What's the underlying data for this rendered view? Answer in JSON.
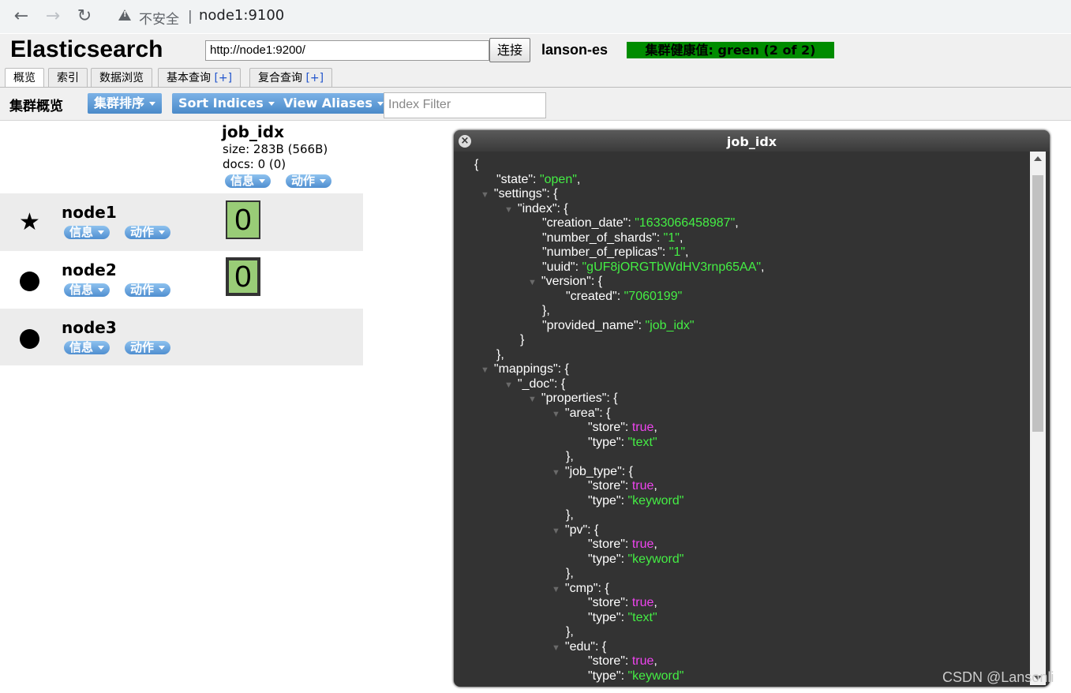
{
  "browser": {
    "back_icon": "arrow-left-icon",
    "forward_icon": "arrow-right-icon",
    "reload_icon": "reload-icon",
    "security_label": "不安全",
    "url": "node1:9100"
  },
  "header": {
    "title": "Elasticsearch",
    "connect_url": "http://node1:9200/",
    "connect_label": "连接",
    "cluster_name": "lanson-es",
    "health": "集群健康值: green (2 of 2)",
    "health_color": "#008c00"
  },
  "tabs": [
    {
      "label": "概览",
      "plus": ""
    },
    {
      "label": "索引",
      "plus": ""
    },
    {
      "label": "数据浏览",
      "plus": ""
    },
    {
      "label": "基本查询",
      "plus": "[+]"
    },
    {
      "label": "复合查询",
      "plus": "[+]"
    }
  ],
  "toolbar": {
    "title": "集群概览",
    "buttons": [
      "集群排序",
      "Sort Indices",
      "View Aliases"
    ],
    "filter_placeholder": "Index Filter",
    "button_color": "#4a8ac9"
  },
  "index": {
    "name": "job_idx",
    "size": "size: 283B (566B)",
    "docs": "docs: 0 (0)",
    "info_label": "信息",
    "action_label": "动作"
  },
  "nodes": [
    {
      "name": "node1",
      "marker": "star-icon",
      "shard": "0"
    },
    {
      "name": "node2",
      "marker": "dot-icon",
      "shard": "0"
    },
    {
      "name": "node3",
      "marker": "dot-icon",
      "shard": ""
    }
  ],
  "node_info_label": "信息",
  "node_action_label": "动作",
  "dialog": {
    "title": "job_idx",
    "lines": [
      {
        "t": "{"
      },
      {
        "k": "state",
        "v": "\"open\"",
        "vt": "s",
        "end": ","
      },
      {
        "k": "settings",
        "open": true
      },
      {
        "k": "index",
        "open": true
      },
      {
        "k": "creation_date",
        "v": "\"1633066458987\"",
        "vt": "s",
        "end": ","
      },
      {
        "k": "number_of_shards",
        "v": "\"1\"",
        "vt": "s",
        "end": ","
      },
      {
        "k": "number_of_replicas",
        "v": "\"1\"",
        "vt": "s",
        "end": ","
      },
      {
        "k": "uuid",
        "v": "\"gUF8jORGTbWdHV3rnp65AA\"",
        "vt": "s",
        "end": ","
      },
      {
        "k": "version",
        "open": true
      },
      {
        "k": "created",
        "v": "\"7060199\"",
        "vt": "s",
        "end": ""
      },
      {
        "t": "},"
      },
      {
        "k": "provided_name",
        "v": "\"job_idx\"",
        "vt": "s",
        "end": ""
      },
      {
        "t": "}"
      },
      {
        "t": "},"
      },
      {
        "k": "mappings",
        "open": true
      },
      {
        "k": "_doc",
        "open": true
      },
      {
        "k": "properties",
        "open": true
      },
      {
        "k": "area",
        "open": true
      },
      {
        "k": "store",
        "v": "true",
        "vt": "b",
        "end": ","
      },
      {
        "k": "type",
        "v": "\"text\"",
        "vt": "s",
        "end": ""
      },
      {
        "t": "},"
      },
      {
        "k": "job_type",
        "open": true
      },
      {
        "k": "store",
        "v": "true",
        "vt": "b",
        "end": ","
      },
      {
        "k": "type",
        "v": "\"keyword\"",
        "vt": "s",
        "end": ""
      },
      {
        "t": "},"
      },
      {
        "k": "pv",
        "open": true
      },
      {
        "k": "store",
        "v": "true",
        "vt": "b",
        "end": ","
      },
      {
        "k": "type",
        "v": "\"keyword\"",
        "vt": "s",
        "end": ""
      },
      {
        "t": "},"
      },
      {
        "k": "cmp",
        "open": true
      },
      {
        "k": "store",
        "v": "true",
        "vt": "b",
        "end": ","
      },
      {
        "k": "type",
        "v": "\"text\"",
        "vt": "s",
        "end": ""
      },
      {
        "t": "},"
      },
      {
        "k": "edu",
        "open": true
      },
      {
        "k": "store",
        "v": "true",
        "vt": "b",
        "end": ","
      },
      {
        "k": "type",
        "v": "\"keyword\"",
        "vt": "s",
        "end": ""
      }
    ]
  },
  "watermark": "CSDN @Lansonli"
}
